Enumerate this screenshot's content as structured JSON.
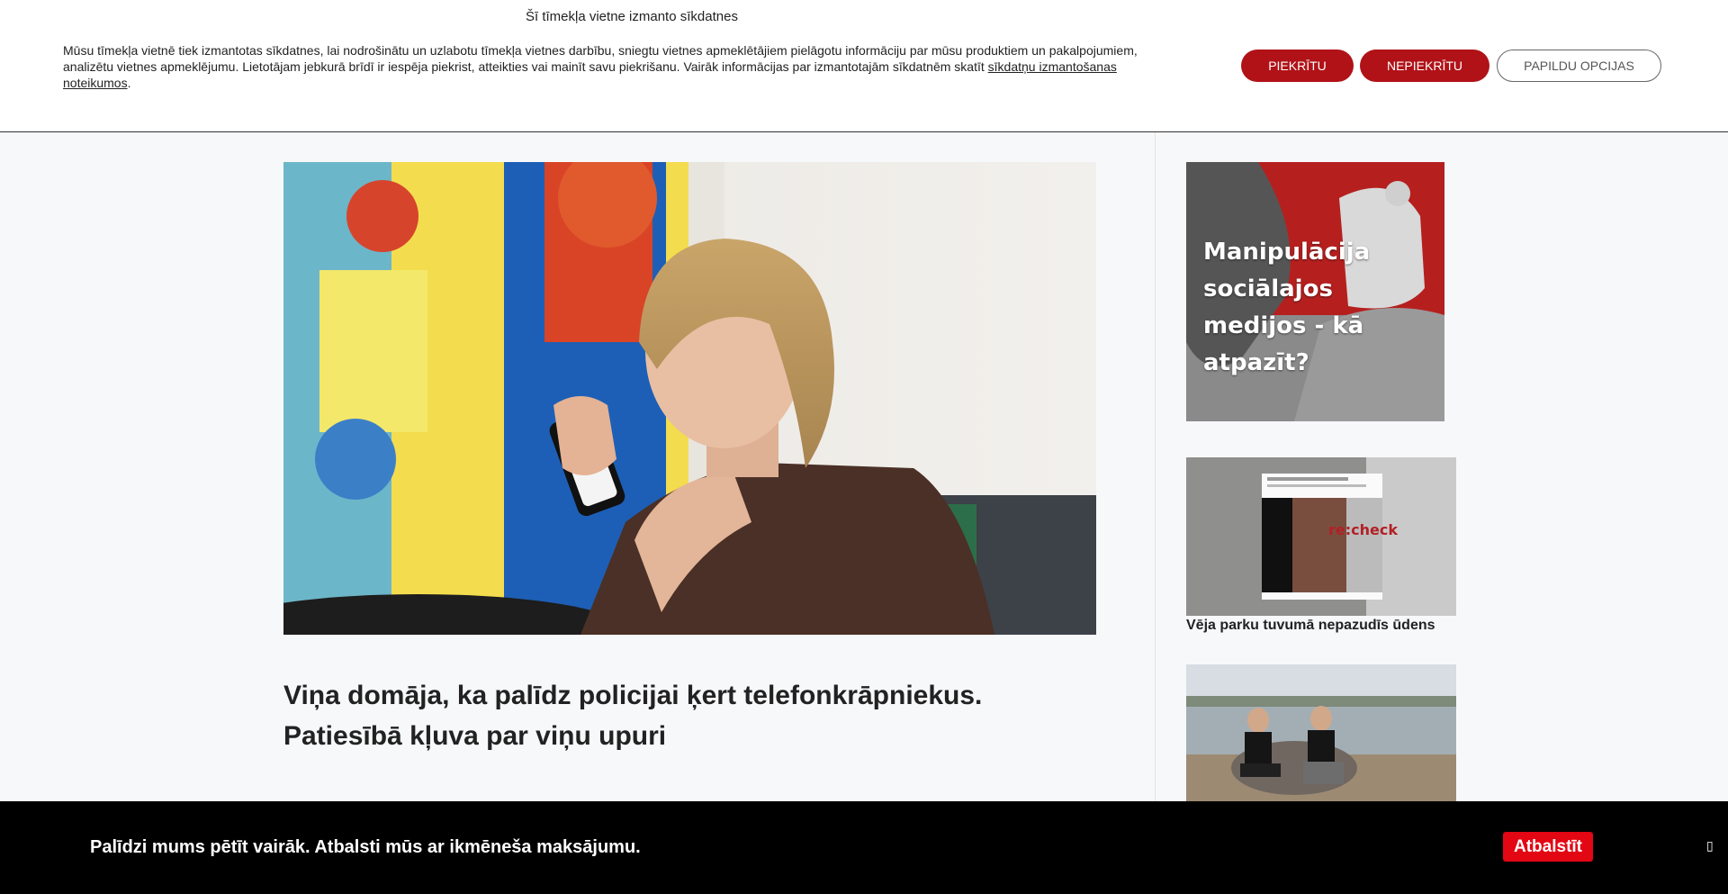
{
  "cookie_banner": {
    "title": "Šī tīmekļa vietne izmanto sīkdatnes",
    "text": "Mūsu tīmekļa vietnē tiek izmantotas sīkdatnes, lai nodrošinātu un uzlabotu tīmekļa vietnes darbību, sniegtu vietnes apmeklētājiem pielāgotu informāciju par mūsu produktiem un pakalpojumiem, analizētu vietnes apmeklējumu. Lietotājam jebkurā brīdī ir iespēja piekrist, atteikties vai mainīt savu piekrišanu. Vairāk informācijas par izmantotajām sīkdatnēm skatīt ",
    "link_text": "sīkdatņu izmantošanas noteikumos",
    "text_end": ".",
    "accept_label": "PIEKRĪTU",
    "decline_label": "NEPIEKRĪTU",
    "more_label": "PAPILDU OPCIJAS"
  },
  "article": {
    "title": "Viņa domāja, ka palīdz policijai ķert telefonkrāpniekus. Patiesībā kļuva par viņu upuri"
  },
  "sidebar": {
    "card1_text": "Manipulācija sociālajos medijos - kā atpazīt?",
    "card2_overlay": "re:check",
    "card2_title": "Vēja parku tuvumā nepazudīs ūdens"
  },
  "support_bar": {
    "text": "Palīdzi mums pētīt vairāk. Atbalsti mūs ar ikmēneša maksājumu.",
    "button_label": "Atbalstīt",
    "close_icon": "▯"
  },
  "colors": {
    "brand_red": "#b01217",
    "support_red": "#e30613"
  }
}
